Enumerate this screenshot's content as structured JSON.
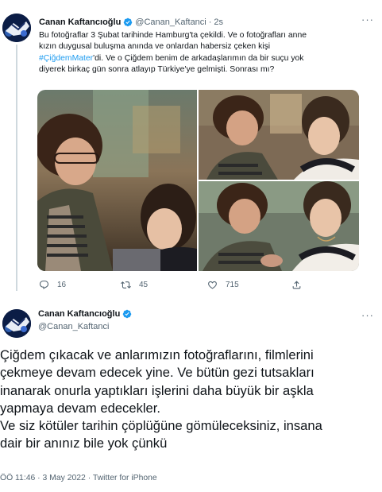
{
  "tweet1": {
    "author_name": "Canan Kaftancıoğlu",
    "author_handle": "@Canan_Kaftanci",
    "separator": "·",
    "time": "2s",
    "more_label": "···",
    "text_lines": [
      "Bu fotoğraflar 3 Şubat tarihinde Hamburg'ta çekildi. Ve o fotoğrafları anne",
      "kızın duygusal buluşma anında ve onlardan habersiz çeken kişi",
      "'di. Ve o Çiğdem benim de arkadaşlarımın da bir suçu yok",
      "diyerek birkaç gün sonra atlayıp Türkiye'ye gelmişti. Sonrası mı?"
    ],
    "hashtag": "#ÇiğdemMater",
    "actions": {
      "reply_count": "16",
      "retweet_count": "45",
      "like_count": "715"
    }
  },
  "tweet2": {
    "author_name": "Canan Kaftancıoğlu",
    "author_handle": "@Canan_Kaftanci",
    "more_label": "···",
    "text_lines": [
      "Çiğdem çıkacak ve anlarımızın fotoğraflarını, filmlerini",
      "çekmeye devam edecek yine. Ve bütün gezi tutsakları",
      "inanarak onurla yaptıkları işlerini daha büyük bir aşkla",
      "yapmaya devam edecekler.",
      "Ve siz kötüler tarihin çöplüğüne gömüleceksiniz, insana",
      "dair bir anınız bile yok çünkü"
    ],
    "meta": "ÖÖ 11:46 · 3 May 2022 · Twitter for iPhone"
  },
  "colors": {
    "accent": "#1d9bf0",
    "text_primary": "#0f1419",
    "text_secondary": "#536471"
  },
  "icons": {
    "verified": "verified-badge-icon",
    "reply": "reply-icon",
    "retweet": "retweet-icon",
    "like": "heart-icon",
    "share": "share-icon",
    "more": "more-horizontal-icon"
  }
}
